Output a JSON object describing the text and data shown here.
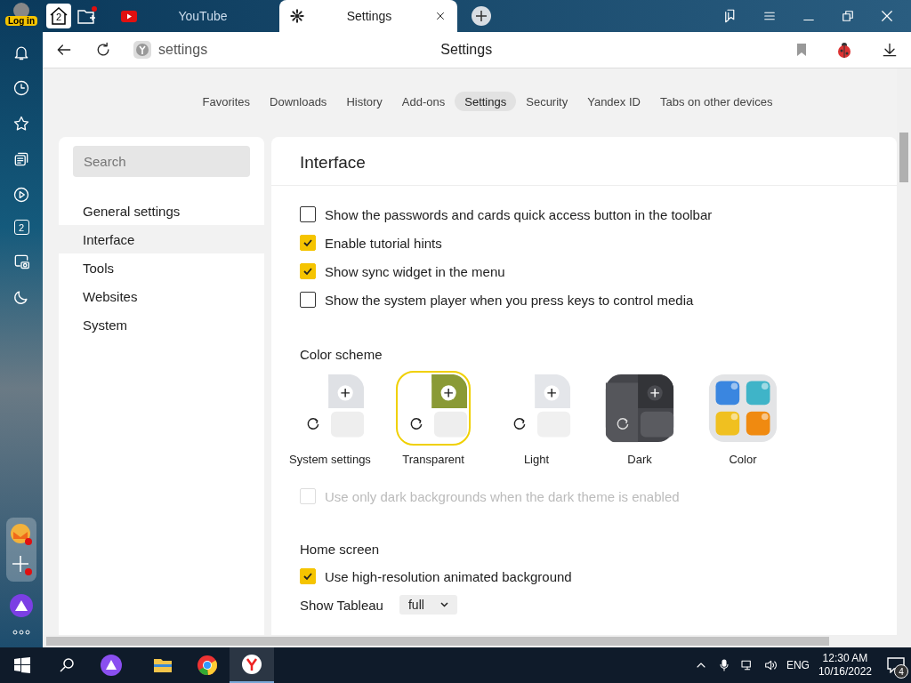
{
  "sidebar": {
    "login_label": "Log in",
    "counter_label": "2"
  },
  "tab_bar": {
    "home_count": "2",
    "tabs": [
      {
        "title": "YouTube",
        "selected": false,
        "kind": "video"
      },
      {
        "title": "Settings",
        "selected": true,
        "kind": "gear"
      }
    ]
  },
  "address_bar": {
    "url": "settings",
    "page_title": "Settings"
  },
  "nav_tabs": [
    {
      "label": "Favorites",
      "selected": false
    },
    {
      "label": "Downloads",
      "selected": false
    },
    {
      "label": "History",
      "selected": false
    },
    {
      "label": "Add-ons",
      "selected": false
    },
    {
      "label": "Settings",
      "selected": true
    },
    {
      "label": "Security",
      "selected": false
    },
    {
      "label": "Yandex ID",
      "selected": false
    },
    {
      "label": "Tabs on other devices",
      "selected": false
    }
  ],
  "settings_menu": {
    "search": {
      "placeholder": "Search"
    },
    "items": [
      {
        "label": "General settings",
        "selected": false
      },
      {
        "label": "Interface",
        "selected": true
      },
      {
        "label": "Tools",
        "selected": false
      },
      {
        "label": "Websites",
        "selected": false
      },
      {
        "label": "System",
        "selected": false
      }
    ]
  },
  "panel": {
    "title": "Interface",
    "general_options": [
      {
        "label": "Show the passwords and cards quick access button in the toolbar",
        "checked": false,
        "disabled": false
      },
      {
        "label": "Enable tutorial hints",
        "checked": true,
        "disabled": false
      },
      {
        "label": "Show sync widget in the menu",
        "checked": true,
        "disabled": false
      },
      {
        "label": "Show the system player when you press keys to control media",
        "checked": false,
        "disabled": false
      }
    ],
    "color_scheme": {
      "heading": "Color scheme",
      "themes": [
        {
          "label": "System settings",
          "kind": "system",
          "selected": false
        },
        {
          "label": "Transparent",
          "kind": "transparent",
          "selected": true
        },
        {
          "label": "Light",
          "kind": "light",
          "selected": false
        },
        {
          "label": "Dark",
          "kind": "dark",
          "selected": false
        },
        {
          "label": "Color",
          "kind": "color",
          "selected": false
        }
      ],
      "dark_option": {
        "label": "Use only dark backgrounds when the dark theme is enabled",
        "checked": false,
        "disabled": true
      }
    },
    "home_screen": {
      "heading": "Home screen",
      "option": {
        "label": "Use high-resolution animated background",
        "checked": true,
        "disabled": false
      },
      "tableau_label": "Show Tableau",
      "tableau_value": "full"
    }
  },
  "taskbar": {
    "language": "ENG",
    "time": "12:30 AM",
    "date": "10/16/2022",
    "notification_count": "4"
  }
}
